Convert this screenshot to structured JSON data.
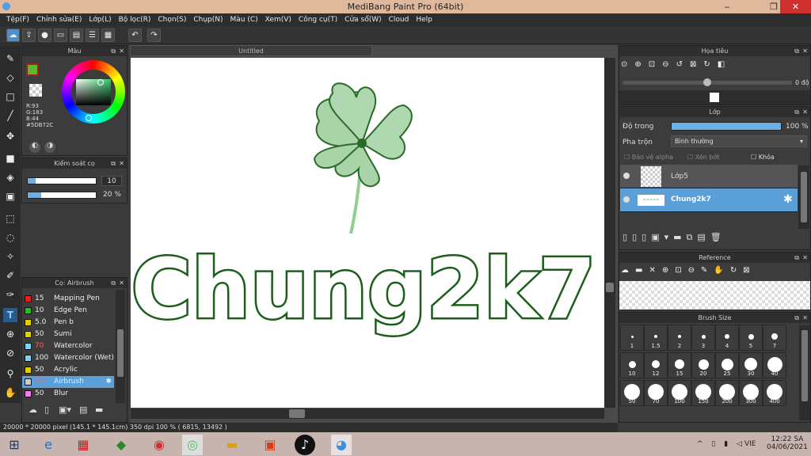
{
  "window": {
    "title": "MediBang Paint Pro (64bit)",
    "minimize": "‒",
    "maximize": "❐",
    "close": "✕"
  },
  "menu": [
    "Tệp(F)",
    "Chỉnh sửa(E)",
    "Lớp(L)",
    "Bộ lọc(R)",
    "Chọn(S)",
    "Chụp(N)",
    "Màu (C)",
    "Xem(V)",
    "Công cụ(T)",
    "Cửa sổ(W)",
    "Cloud",
    "Help"
  ],
  "color_panel": {
    "title": "Màu",
    "r": "R:93",
    "g": "G:183",
    "b": "B:44",
    "hex": "#5DB72C",
    "fg": "#5DB72C",
    "bg": "#ffffff"
  },
  "brush_control": {
    "title": "Kiểm soát cọ",
    "size_value": "10",
    "opacity_value": "20 %",
    "size_fraction": 0.12,
    "opacity_fraction": 0.2
  },
  "brush_list": {
    "title": "Cọ: Airbrush",
    "items": [
      {
        "size": "15",
        "name": "Mapping Pen",
        "color": "#e02020"
      },
      {
        "size": "10",
        "name": "Edge Pen",
        "color": "#20c020"
      },
      {
        "size": "5.0",
        "name": " Pen b",
        "color": "#e0d000"
      },
      {
        "size": "50",
        "name": "Sumi",
        "color": "#e0d000"
      },
      {
        "size": "70",
        "name": "Watercolor",
        "color": "#80d0f0",
        "size_color": "#ff6060"
      },
      {
        "size": "100",
        "name": "Watercolor (Wet)",
        "color": "#80d0f0"
      },
      {
        "size": "50",
        "name": "Acrylic",
        "color": "#e0d000"
      },
      {
        "size": "10",
        "name": "Airbrush",
        "color": "#cccccc",
        "size_color": "#ff6060",
        "selected": true
      },
      {
        "size": "50",
        "name": "Blur",
        "color": "#f080f0"
      }
    ]
  },
  "document": {
    "tab": "Untitled",
    "art_text": "Chung2k7"
  },
  "status": {
    "text": "20000 * 20000 pixel   (145.1 * 145.1cm)   350 dpi   100 %   ( 6815, 13492 )"
  },
  "navigator": {
    "title": "Họa tiêu",
    "angle": "0 độ"
  },
  "layers": {
    "title": "Lớp",
    "opacity_label": "Độ trong",
    "opacity_value": "100 %",
    "blend_label": "Pha trộn",
    "blend_value": "Bình thường",
    "protect_alpha": "Bảo vệ alpha",
    "clip": "Xén bớt",
    "lock": "Khóa",
    "items": [
      {
        "name": "Lớp5",
        "selected": false
      },
      {
        "name": "Chung2k7",
        "selected": true
      }
    ]
  },
  "reference": {
    "title": "Reference"
  },
  "brush_size": {
    "title": "Brush Size",
    "sizes": [
      "1",
      "1.5",
      "2",
      "3",
      "4",
      "5",
      "7",
      "10",
      "12",
      "15",
      "20",
      "25",
      "30",
      "40",
      "50",
      "70",
      "100",
      "150",
      "200",
      "300",
      "400"
    ]
  },
  "taskbar": {
    "lang": "VIE",
    "time": "12:22 SA",
    "date": "04/06/2021"
  }
}
